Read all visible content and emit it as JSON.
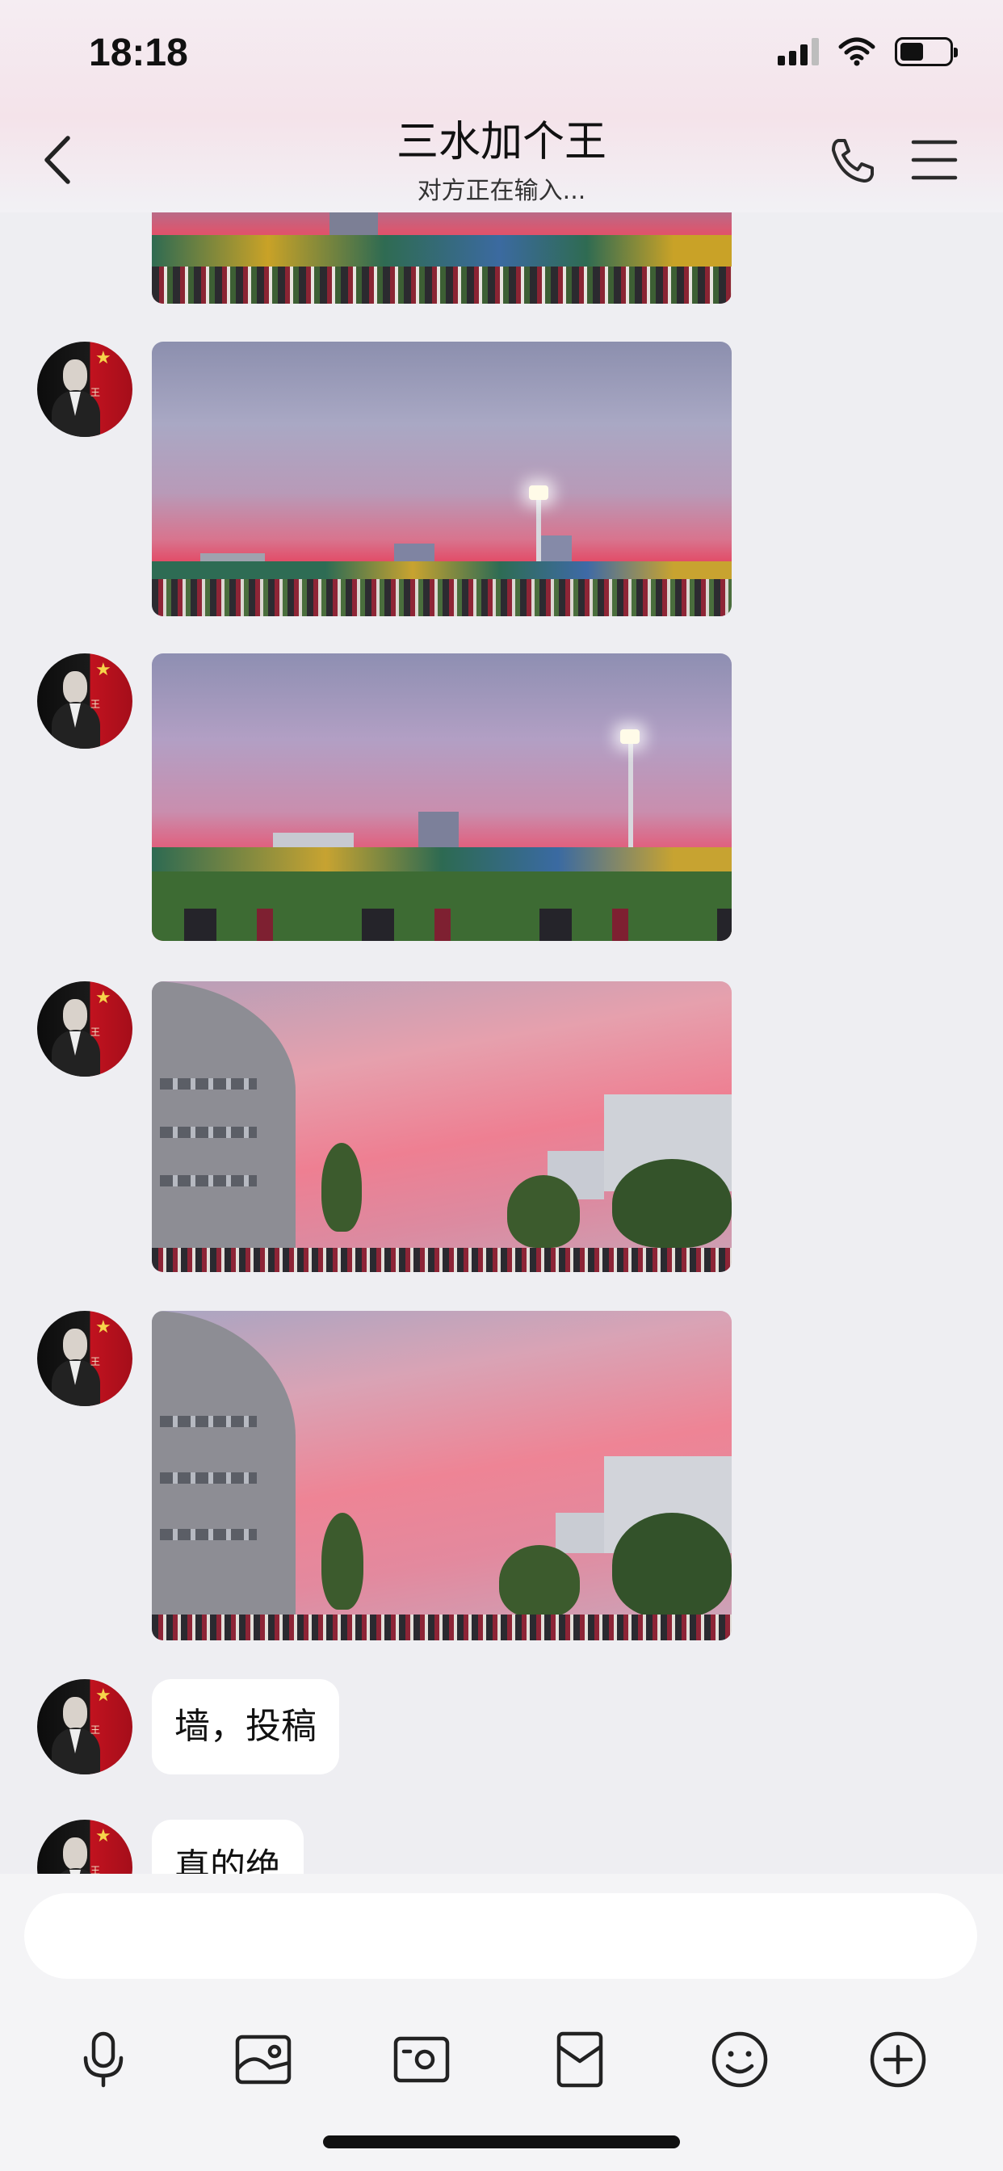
{
  "status_bar": {
    "time": "18:18"
  },
  "header": {
    "title": "三水加个王",
    "subtitle": "对方正在输入..."
  },
  "messages": [
    {
      "type": "image",
      "description_icon": "stadium-sunset-photo-partial"
    },
    {
      "type": "image",
      "description_icon": "stadium-sunset-photo"
    },
    {
      "type": "image",
      "description_icon": "stadium-field-sunset-photo"
    },
    {
      "type": "image",
      "description_icon": "campus-pink-sky-photo"
    },
    {
      "type": "image",
      "description_icon": "campus-pink-sky-photo"
    },
    {
      "type": "text",
      "text": "墙，投稿"
    },
    {
      "type": "text",
      "text": "真的绝"
    }
  ],
  "composer": {
    "placeholder": ""
  },
  "toolbar": {
    "icons": [
      "microphone-icon",
      "image-icon",
      "camera-icon",
      "red-packet-icon",
      "emoji-icon",
      "plus-icon"
    ]
  },
  "colors": {
    "background": "#eeeef2",
    "bubble": "#ffffff",
    "header_tint": "#f4e3ea"
  }
}
